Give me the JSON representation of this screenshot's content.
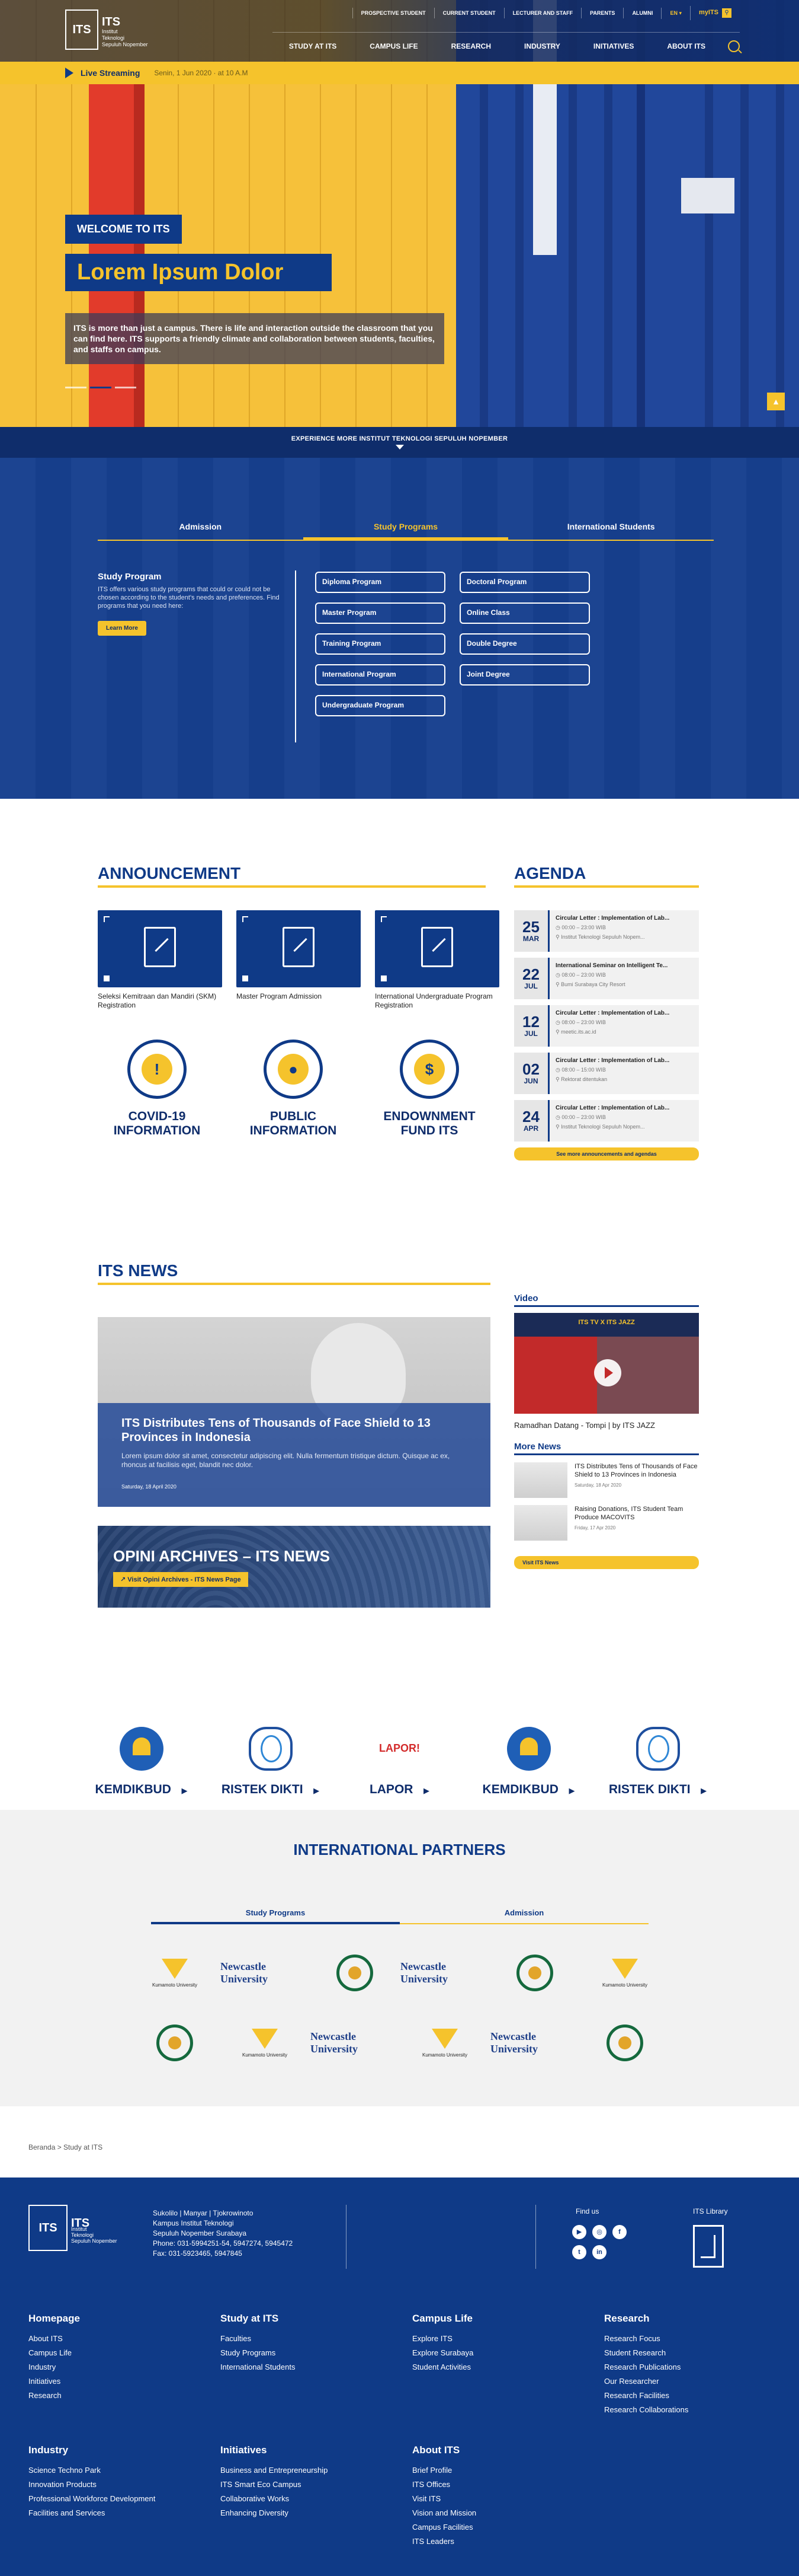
{
  "header": {
    "logo_text": "ITS",
    "logo_sub": [
      "Institut",
      "Teknologi",
      "Sepuluh Nopember"
    ],
    "util_links": [
      "PROSPECTIVE STUDENT",
      "CURRENT STUDENT",
      "LECTURER AND STAFF",
      "PARENTS",
      "ALUMNI"
    ],
    "lang": "EN",
    "myits": "myITS",
    "nav": [
      "STUDY AT ITS",
      "CAMPUS LIFE",
      "RESEARCH",
      "INDUSTRY",
      "INITIATIVES",
      "ABOUT ITS"
    ]
  },
  "live": {
    "label": "Live Streaming",
    "datetime": "Senin, 1 Jun 2020 · at 10 A.M"
  },
  "hero": {
    "welcome": "WELCOME TO ITS",
    "title": "Lorem Ipsum Dolor",
    "desc": "ITS is more than just a campus. There is life and interaction outside the classroom that you can find here. ITS supports a friendly climate and collaboration between students, faculties, and staffs on campus."
  },
  "experience": "EXPERIENCE MORE INSTITUT TEKNOLOGI SEPULUH NOPEMBER",
  "programs": {
    "tabs": [
      "Admission",
      "Study Programs",
      "International Students"
    ],
    "active_tab": 1,
    "info_title": "Study Program",
    "info_desc": "ITS offers various study programs that could or could not be chosen according to the student's needs and preferences. Find programs that you need here:",
    "learn_more": "Learn More",
    "items": [
      "Diploma Program",
      "Doctoral Program",
      "Master Program",
      "Online Class",
      "Training Program",
      "Double Degree",
      "International Program",
      "Joint Degree",
      "Undergraduate Program"
    ]
  },
  "announcement": {
    "title": "ANNOUNCEMENT",
    "cards": [
      {
        "caption": "Seleksi Kemitraan dan Mandiri (SKM) Registration"
      },
      {
        "caption": "Master Program Admission"
      },
      {
        "caption": "International Undergraduate Program Registration"
      }
    ],
    "infos": [
      {
        "icon": "exclamation-icon",
        "glyph": "!",
        "title": "COVID-19 INFORMATION"
      },
      {
        "icon": "person-icon",
        "glyph": "●",
        "title": "PUBLIC INFORMATION"
      },
      {
        "icon": "dollar-icon",
        "glyph": "$",
        "title": "ENDOWNMENT FUND ITS"
      }
    ]
  },
  "agenda": {
    "title": "AGENDA",
    "items": [
      {
        "day": "25",
        "month": "MAR",
        "title": "Circular Letter : Implementation of Lab...",
        "time": "00:00 – 23:00 WIB",
        "place": "Institut Teknologi Sepuluh Nopem..."
      },
      {
        "day": "22",
        "month": "JUL",
        "title": "International Seminar on Intelligent Te...",
        "time": "08:00 – 23:00 WIB",
        "place": "Bumi Surabaya City Resort"
      },
      {
        "day": "12",
        "month": "JUL",
        "title": "Circular Letter : Implementation of Lab...",
        "time": "08:00 – 23:00 WIB",
        "place": "meetic.its.ac.id"
      },
      {
        "day": "02",
        "month": "JUN",
        "title": "Circular Letter : Implementation of Lab...",
        "time": "08:00 – 15:00 WIB",
        "place": "Rektorat ditentukan"
      },
      {
        "day": "24",
        "month": "APR",
        "title": "Circular Letter : Implementation of Lab...",
        "time": "00:00 – 23:00 WIB",
        "place": "Institut Teknologi Sepuluh Nopem..."
      }
    ],
    "more": "See more announcements and agendas"
  },
  "its_news": {
    "title": "ITS NEWS",
    "featured_title": "ITS Distributes Tens of Thousands of Face Shield to 13 Provinces in Indonesia",
    "featured_desc": "Lorem ipsum dolor sit amet, consectetur adipiscing elit. Nulla fermentum tristique dictum. Quisque ac ex, rhoncus at facilisis eget, blandit nec dolor.",
    "featured_date": "Saturday, 18 April 2020",
    "opini_title": "OPINI ARCHIVES – ITS NEWS",
    "opini_button": "Visit Opini Archives - ITS News Page",
    "video_label": "Video",
    "video_banner": "ITS TV X ITS JAZZ",
    "video_caption": "Ramadhan Datang - Tompi | by ITS JAZZ",
    "more_label": "More News",
    "more": [
      {
        "title": "ITS Distributes Tens of Thousands of Face Shield to 13 Provinces in Indonesia",
        "date": "Saturday, 18 Apr 2020"
      },
      {
        "title": "Raising Donations, ITS Student Team Produce MACOVITS",
        "date": "Friday, 17 Apr 2020"
      }
    ],
    "visit": "Visit ITS News"
  },
  "links": [
    {
      "name": "KEMDIKBUD",
      "icon": "kemdikbud-logo"
    },
    {
      "name": "RISTEK DIKTI",
      "icon": "ristekdikti-logo"
    },
    {
      "name": "LAPOR",
      "icon": "lapor-logo"
    },
    {
      "name": "KEMDIKBUD",
      "icon": "kemdikbud-logo"
    },
    {
      "name": "RISTEK DIKTI",
      "icon": "ristekdikti-logo"
    }
  ],
  "partners": {
    "title": "INTERNATIONAL PARTNERS",
    "tabs": [
      "Study Programs",
      "Admission"
    ],
    "row1": [
      "Kumamoto University",
      "Newcastle University",
      "zamorano",
      "Newcastle University",
      "zamorano",
      "Kumamoto University"
    ],
    "row2": [
      "zamorano",
      "Kumamoto University",
      "Newcastle University",
      "Kumamoto University",
      "Newcastle University",
      "zamorano"
    ]
  },
  "breadcrumb": "Beranda > Study at ITS",
  "footer": {
    "address": [
      "Sukolilo | Manyar | Tjokrowinoto",
      "Kampus Institut Teknologi",
      "Sepuluh Nopember Surabaya",
      "Phone: 031-5994251-54, 5947274, 5945472",
      "Fax: 031-5923465, 5947845"
    ],
    "find_us": "Find us",
    "library": "ITS Library",
    "columns": [
      {
        "title": "Homepage",
        "links": [
          "About ITS",
          "Campus Life",
          "Industry",
          "Initiatives",
          "Research"
        ]
      },
      {
        "title": "Study at ITS",
        "links": [
          "Faculties",
          "Study Programs",
          "International Students"
        ]
      },
      {
        "title": "Campus Life",
        "links": [
          "Explore ITS",
          "Explore Surabaya",
          "Student Activities"
        ]
      },
      {
        "title": "Research",
        "links": [
          "Research Focus",
          "Student Research",
          "Research Publications",
          "Our Researcher",
          "Research Facilities",
          "Research Collaborations"
        ]
      },
      {
        "title": "Industry",
        "links": [
          "Science Techno Park",
          "Innovation Products",
          "Professional Workforce Development",
          "Facilities and Services"
        ]
      },
      {
        "title": "Initiatives",
        "links": [
          "Business and Entrepreneurship",
          "ITS Smart Eco Campus",
          "Collaborative Works",
          "Enhancing Diversity"
        ]
      },
      {
        "title": "About ITS",
        "links": [
          "Brief Profile",
          "ITS Offices",
          "Visit ITS",
          "Vision and Mission",
          "Campus Facilities",
          "ITS Leaders"
        ]
      }
    ]
  }
}
